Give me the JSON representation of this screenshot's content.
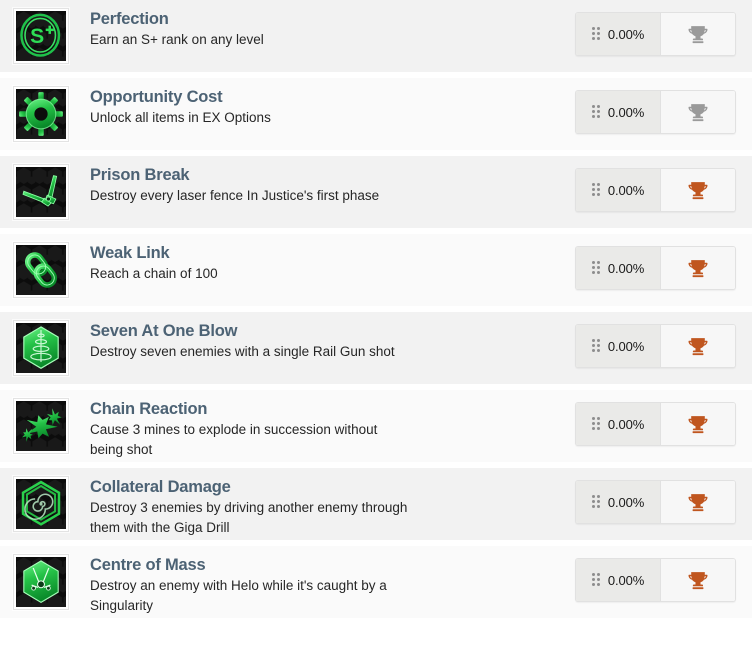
{
  "colors": {
    "title": "#4c6274",
    "description": "#262626",
    "row_dark": "#f2f2f2",
    "row_light": "#fafafa",
    "trophy_locked": "#9a9a9a",
    "trophy_bronze": "#c0561f",
    "icon_green": "#2fd04f",
    "icon_background": "#0c0c0c"
  },
  "achievements": [
    {
      "icon_name": "s-plus-rank-icon",
      "title": "Perfection",
      "description": "Earn an S+ rank on any level",
      "progress": "0.00%",
      "trophy": "gray",
      "drag_handle": "drag-handle-icon"
    },
    {
      "icon_name": "gear-icon",
      "title": "Opportunity Cost",
      "description": "Unlock all items in EX Options",
      "progress": "0.00%",
      "trophy": "gray",
      "drag_handle": "drag-handle-icon"
    },
    {
      "icon_name": "bolt-cutters-icon",
      "title": "Prison Break",
      "description": "Destroy every laser fence In Justice's first phase",
      "progress": "0.00%",
      "trophy": "bronze",
      "drag_handle": "drag-handle-icon"
    },
    {
      "icon_name": "chain-link-icon",
      "title": "Weak Link",
      "description": "Reach a chain of 100",
      "progress": "0.00%",
      "trophy": "bronze",
      "drag_handle": "drag-handle-icon"
    },
    {
      "icon_name": "rail-gun-spiral-hex-icon",
      "title": "Seven At One Blow",
      "description": "Destroy seven enemies with a single Rail Gun shot",
      "progress": "0.00%",
      "trophy": "bronze",
      "drag_handle": "drag-handle-icon"
    },
    {
      "icon_name": "explosion-splat-icon",
      "title": "Chain Reaction",
      "description": "Cause 3 mines to explode in succession without being shot",
      "progress": "0.00%",
      "trophy": "bronze",
      "drag_handle": "drag-handle-icon"
    },
    {
      "icon_name": "giga-drill-spiral-hex-icon",
      "title": "Collateral Damage",
      "description": "Destroy 3 enemies by driving another enemy through them with the Giga Drill",
      "progress": "0.00%",
      "trophy": "bronze",
      "drag_handle": "drag-handle-icon"
    },
    {
      "icon_name": "singularity-hex-icon",
      "title": "Centre of Mass",
      "description": "Destroy an enemy with Helo while it's caught by a Singularity",
      "progress": "0.00%",
      "trophy": "bronze",
      "drag_handle": "drag-handle-icon"
    }
  ]
}
